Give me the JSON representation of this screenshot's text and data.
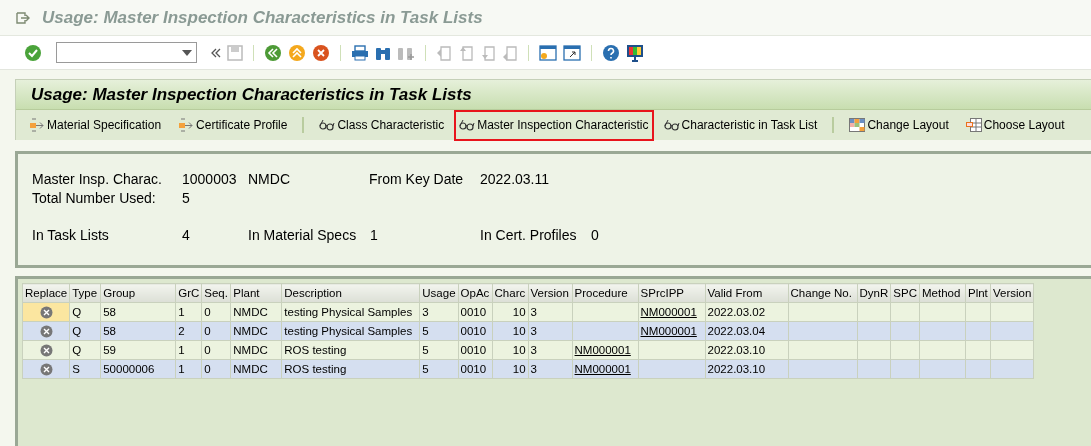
{
  "window": {
    "title": "Usage: Master Inspection Characteristics in Task Lists"
  },
  "header": {
    "title": "Usage: Master Inspection Characteristics in Task Lists"
  },
  "app_buttons": [
    {
      "label": "Material Specification",
      "kind": "transfer",
      "highlighted": false,
      "separator_before": false
    },
    {
      "label": "Certificate Profile",
      "kind": "transfer",
      "highlighted": false,
      "separator_before": false
    },
    {
      "label": "Class Characteristic",
      "kind": "characteristic",
      "highlighted": false,
      "separator_before": true
    },
    {
      "label": "Master Inspection Characteristic",
      "kind": "characteristic",
      "highlighted": true,
      "separator_before": false
    },
    {
      "label": "Characteristic in Task List",
      "kind": "characteristic",
      "highlighted": false,
      "separator_before": false
    },
    {
      "label": "Change Layout",
      "kind": "change_layout",
      "highlighted": false,
      "separator_before": true
    },
    {
      "label": "Choose Layout",
      "kind": "choose_layout",
      "highlighted": false,
      "separator_before": false
    }
  ],
  "info": {
    "mic_label": "Master Insp. Charac.",
    "mic_value": "1000003",
    "mic_plant": "NMDC",
    "key_date_label": "From Key Date",
    "key_date": "2022.03.11",
    "total_label": "Total Number Used:",
    "total": "5",
    "task_lists_label": "In Task Lists",
    "task_lists": "4",
    "mat_specs_label": "In Material Specs",
    "mat_specs": "1",
    "cert_label": "In Cert. Profiles",
    "cert": "0"
  },
  "table": {
    "columns": [
      {
        "label": "Replace",
        "kind": "icon"
      },
      {
        "label": "Type",
        "kind": "text"
      },
      {
        "label": "Group",
        "kind": "text"
      },
      {
        "label": "GrC",
        "kind": "text"
      },
      {
        "label": "Seq.",
        "kind": "text"
      },
      {
        "label": "Plant",
        "kind": "text"
      },
      {
        "label": "Description",
        "kind": "text"
      },
      {
        "label": "Usage",
        "kind": "text"
      },
      {
        "label": "OpAc",
        "kind": "text"
      },
      {
        "label": "Charc",
        "kind": "number"
      },
      {
        "label": "Version",
        "kind": "text"
      },
      {
        "label": "Procedure",
        "kind": "link"
      },
      {
        "label": "SPrcIPP",
        "kind": "link"
      },
      {
        "label": "Valid From",
        "kind": "text"
      },
      {
        "label": "Change No.",
        "kind": "text"
      },
      {
        "label": "DynR",
        "kind": "text"
      },
      {
        "label": "SPC",
        "kind": "text"
      },
      {
        "label": "Method",
        "kind": "text"
      },
      {
        "label": "Plnt",
        "kind": "text"
      },
      {
        "label": "Version",
        "kind": "text"
      }
    ],
    "rows": [
      {
        "selected": true,
        "cells": [
          "",
          "Q",
          "58",
          "1",
          "0",
          "NMDC",
          "testing Physical Samples",
          "3",
          "0010",
          "10",
          "3",
          "",
          "NM000001",
          "2022.03.02",
          "",
          "",
          "",
          "",
          "",
          ""
        ]
      },
      {
        "selected": false,
        "cells": [
          "",
          "Q",
          "58",
          "2",
          "0",
          "NMDC",
          "testing Physical Samples",
          "5",
          "0010",
          "10",
          "3",
          "",
          "NM000001",
          "2022.03.04",
          "",
          "",
          "",
          "",
          "",
          ""
        ]
      },
      {
        "selected": false,
        "cells": [
          "",
          "Q",
          "59",
          "1",
          "0",
          "NMDC",
          "ROS testing",
          "5",
          "0010",
          "10",
          "3",
          "NM000001",
          "",
          "2022.03.10",
          "",
          "",
          "",
          "",
          "",
          ""
        ]
      },
      {
        "selected": false,
        "cells": [
          "",
          "S",
          "50000006",
          "1",
          "0",
          "NMDC",
          "ROS testing",
          "5",
          "0010",
          "10",
          "3",
          "NM000001",
          "",
          "2022.03.10",
          "",
          "",
          "",
          "",
          "",
          ""
        ]
      }
    ]
  }
}
